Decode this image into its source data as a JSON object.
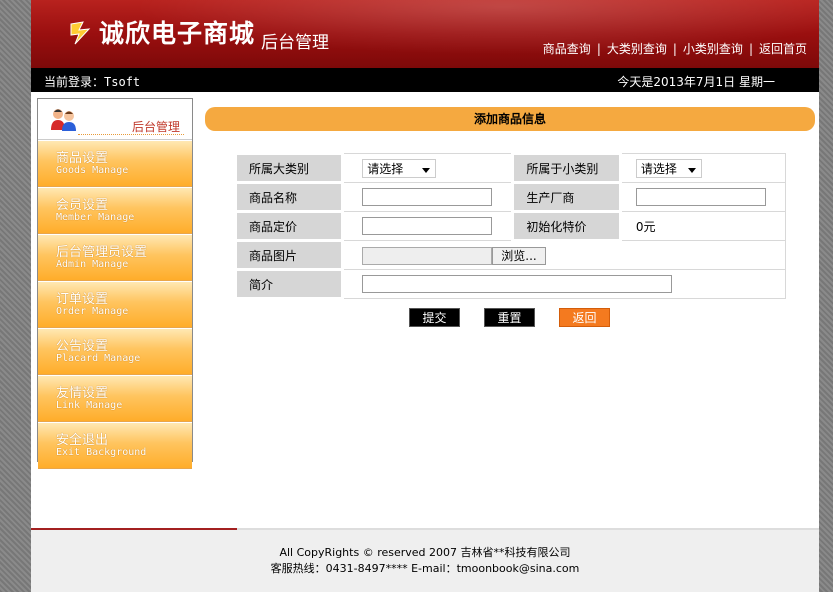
{
  "header": {
    "logo_text": "诚欣电子商城",
    "logo_sub": "后台管理",
    "nav": [
      "商品查询",
      "大类别查询",
      "小类别查询",
      "返回首页"
    ]
  },
  "infobar": {
    "login_label": "当前登录：",
    "login_user": "Tsoft",
    "date_text": "今天是2013年7月1日  星期一"
  },
  "sidebar": {
    "title": "后台管理",
    "items": [
      {
        "zh": "商品设置",
        "en": "Goods Manage"
      },
      {
        "zh": "会员设置",
        "en": "Member Manage"
      },
      {
        "zh": "后台管理员设置",
        "en": "Admin Manage"
      },
      {
        "zh": "订单设置",
        "en": "Order Manage"
      },
      {
        "zh": "公告设置",
        "en": "Placard Manage"
      },
      {
        "zh": "友情设置",
        "en": "Link Manage"
      },
      {
        "zh": "安全退出",
        "en": "Exit Background"
      }
    ]
  },
  "main": {
    "title": "添加商品信息",
    "form": {
      "big_category_label": "所属大类别",
      "big_category_value": "请选择",
      "small_category_label": "所属于小类别",
      "small_category_value": "请选择",
      "name_label": "商品名称",
      "maker_label": "生产厂商",
      "price_label": "商品定价",
      "special_price_label": "初始化特价",
      "special_price_value": "0元",
      "image_label": "商品图片",
      "browse_label": "浏览...",
      "intro_label": "简介"
    },
    "buttons": {
      "submit": "提交",
      "reset": "重置",
      "back": "返回"
    }
  },
  "footer": {
    "copyright": "All CopyRights © reserved 2007 吉林省**科技有限公司",
    "hotline": "客服热线：0431-8497****  E-mail：tmoonbook@sina.com"
  },
  "colors": {
    "header_red": "#9a0f0f",
    "menu_orange": "#ffad2a",
    "title_bar": "#f5a940",
    "back_button": "#f47a1f"
  }
}
